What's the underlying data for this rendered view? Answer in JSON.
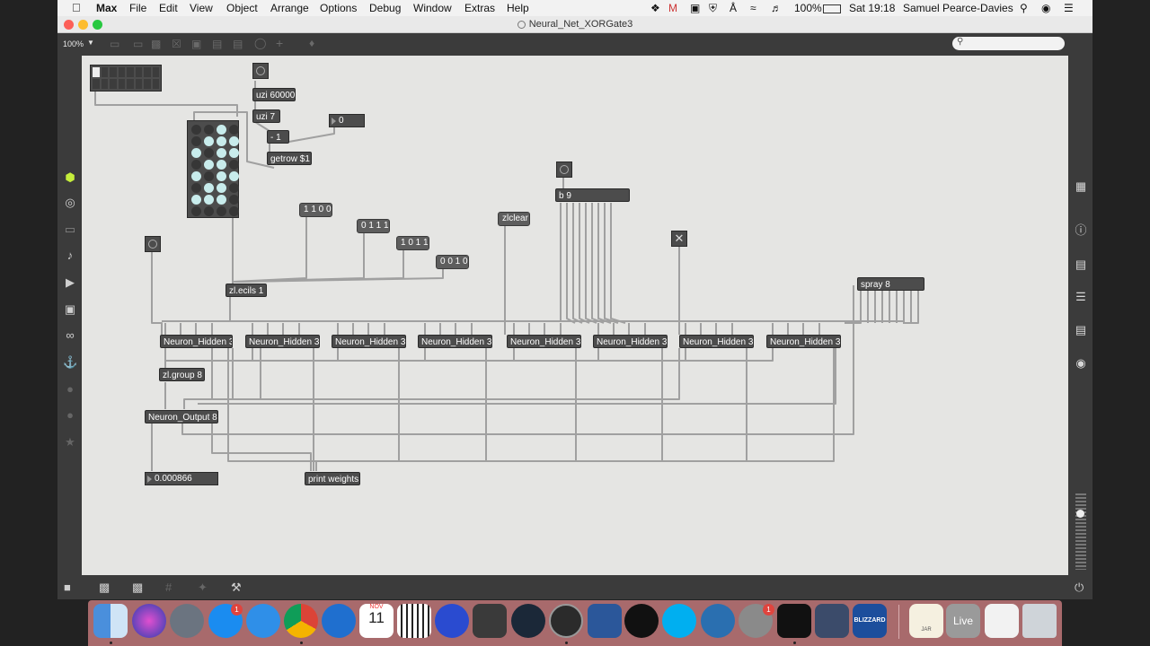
{
  "menubar": {
    "apple_icon": "apple-icon",
    "app_name": "Max",
    "items": [
      "File",
      "Edit",
      "View",
      "Object",
      "Arrange",
      "Options",
      "Debug",
      "Window",
      "Extras",
      "Help"
    ],
    "battery": "100%",
    "clock": "Sat 19:18",
    "user": "Samuel Pearce-Davies"
  },
  "window": {
    "title": "Neural_Net_XORGate3",
    "zoom": "100%",
    "search_placeholder": ""
  },
  "patch": {
    "objects": {
      "uzi_a": "uzi 60000",
      "uzi_b": "uzi 7",
      "minus": "- 1",
      "getrow": "getrow $1",
      "buffer": "b 9",
      "zl_ecils": "zl.ecils 1",
      "spray": "spray 8",
      "zl_group": "zl.group 8",
      "neuron_output": "Neuron_Output 8",
      "print_weights": "print weights",
      "neurons": [
        "Neuron_Hidden 3",
        "Neuron_Hidden 3",
        "Neuron_Hidden 3",
        "Neuron_Hidden 3",
        "Neuron_Hidden 3",
        "Neuron_Hidden 3",
        "Neuron_Hidden 3",
        "Neuron_Hidden 3"
      ]
    },
    "messages": {
      "m1": "1 1 0 0",
      "m2": "0 1 1 1",
      "m3": "1 0 1 1",
      "m4": "0 0 1 0",
      "zlclear": "zlclear"
    },
    "numbers": {
      "counter": "0",
      "output": "0.000866"
    }
  },
  "dock": {
    "calendar_month": "NOV",
    "calendar_day": "11",
    "badge_appstore": "1",
    "badge_prefs": "1",
    "jar_label": "JAR",
    "live_label": "Live",
    "blizzard_label": "BLIZZARD"
  },
  "colors": {
    "canvas": "#e5e5e3",
    "object": "#4c4c4c",
    "wire": "#9a9a9a",
    "led_on": "#c8ecec",
    "dock": "#a86a6c"
  }
}
